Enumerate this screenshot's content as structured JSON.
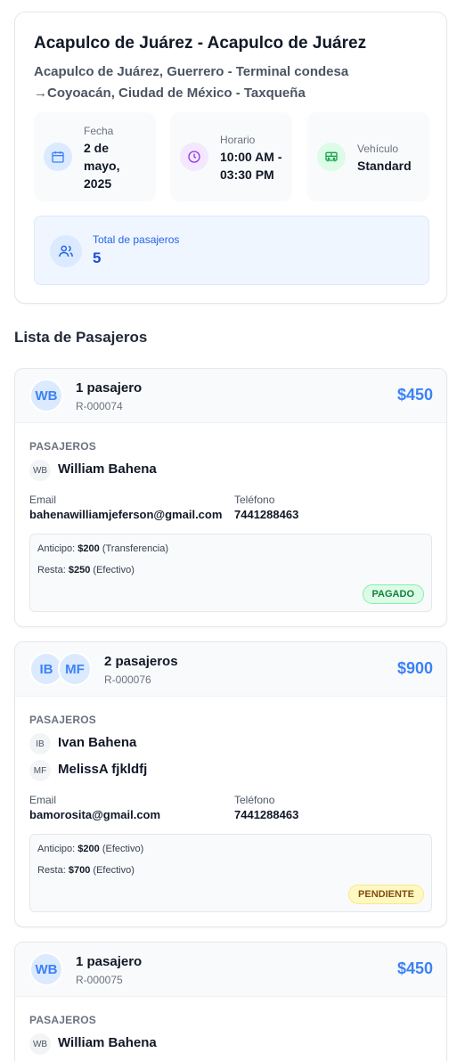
{
  "trip": {
    "title": "Acapulco de Juárez - Acapulco de Juárez",
    "subtitle": "Acapulco de Juárez, Guerrero - Terminal condesa →Coyoacán, Ciudad de México - Taxqueña",
    "date": {
      "label": "Fecha",
      "value": "2 de mayo, 2025",
      "icon": "calendar-icon"
    },
    "time": {
      "label": "Horario",
      "value": "10:00 AM - 03:30 PM",
      "icon": "clock-icon"
    },
    "vehicle": {
      "label": "Vehículo",
      "value": "Standard",
      "icon": "bus-icon"
    },
    "total": {
      "label": "Total de pasajeros",
      "value": "5",
      "icon": "users-icon"
    }
  },
  "section_title": "Lista de Pasajeros",
  "labels": {
    "passengers": "PASAJEROS",
    "email": "Email",
    "phone": "Teléfono",
    "advance": "Anticipo:",
    "remaining": "Resta:"
  },
  "reservations": [
    {
      "count_label": "1 pasajero",
      "code": "R-000074",
      "price": "$450",
      "avatars": [
        "WB"
      ],
      "passengers": [
        {
          "initials": "WB",
          "name": "William Bahena"
        }
      ],
      "email": "bahenawilliamjeferson@gmail.com",
      "phone": "7441288463",
      "advance_amount": "$200",
      "advance_method": "(Transferencia)",
      "remaining_amount": "$250",
      "remaining_method": "(Efectivo)",
      "status": "PAGADO"
    },
    {
      "count_label": "2 pasajeros",
      "code": "R-000076",
      "price": "$900",
      "avatars": [
        "IB",
        "MF"
      ],
      "passengers": [
        {
          "initials": "IB",
          "name": "Ivan Bahena"
        },
        {
          "initials": "MF",
          "name": "MelissA fjkldfj"
        }
      ],
      "email": "bamorosita@gmail.com",
      "phone": "7441288463",
      "advance_amount": "$200",
      "advance_method": "(Efectivo)",
      "remaining_amount": "$700",
      "remaining_method": "(Efectivo)",
      "status": "PENDIENTE"
    },
    {
      "count_label": "1 pasajero",
      "code": "R-000075",
      "price": "$450",
      "avatars": [
        "WB"
      ],
      "passengers": [
        {
          "initials": "WB",
          "name": "William Bahena"
        }
      ]
    }
  ],
  "colors": {
    "accent": "#3b82f6",
    "paid_bg": "#dcfce7",
    "pending_bg": "#fef9c3"
  }
}
